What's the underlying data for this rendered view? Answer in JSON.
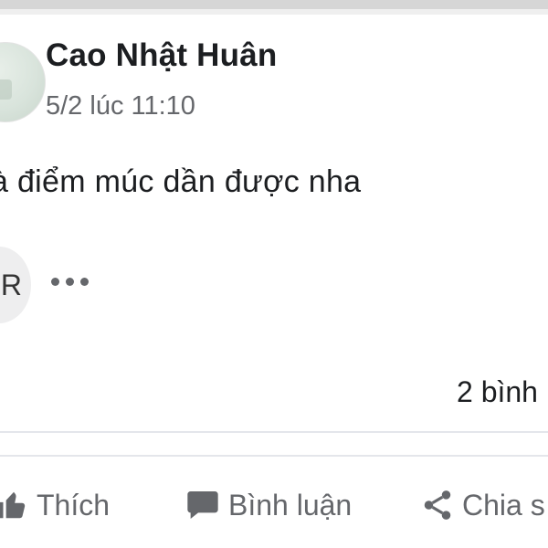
{
  "post": {
    "author": "Cao Nhật Huân",
    "timestamp": "5/2 lúc 11:10",
    "text": "à điểm múc dần được nha"
  },
  "comment_preview": {
    "avatar_initial": "R"
  },
  "stats": {
    "comments": "2 bình"
  },
  "actions": {
    "like_label": "Thích",
    "comment_label": "Bình luận",
    "share_label": "Chia s"
  },
  "icons": {
    "like": "thumbs-up-icon",
    "comment": "comment-bubble-icon",
    "share": "share-icon",
    "more": "more-dots-icon"
  },
  "colors": {
    "text_primary": "#1c1e21",
    "text_secondary": "#65676b",
    "divider": "#e4e6eb"
  }
}
